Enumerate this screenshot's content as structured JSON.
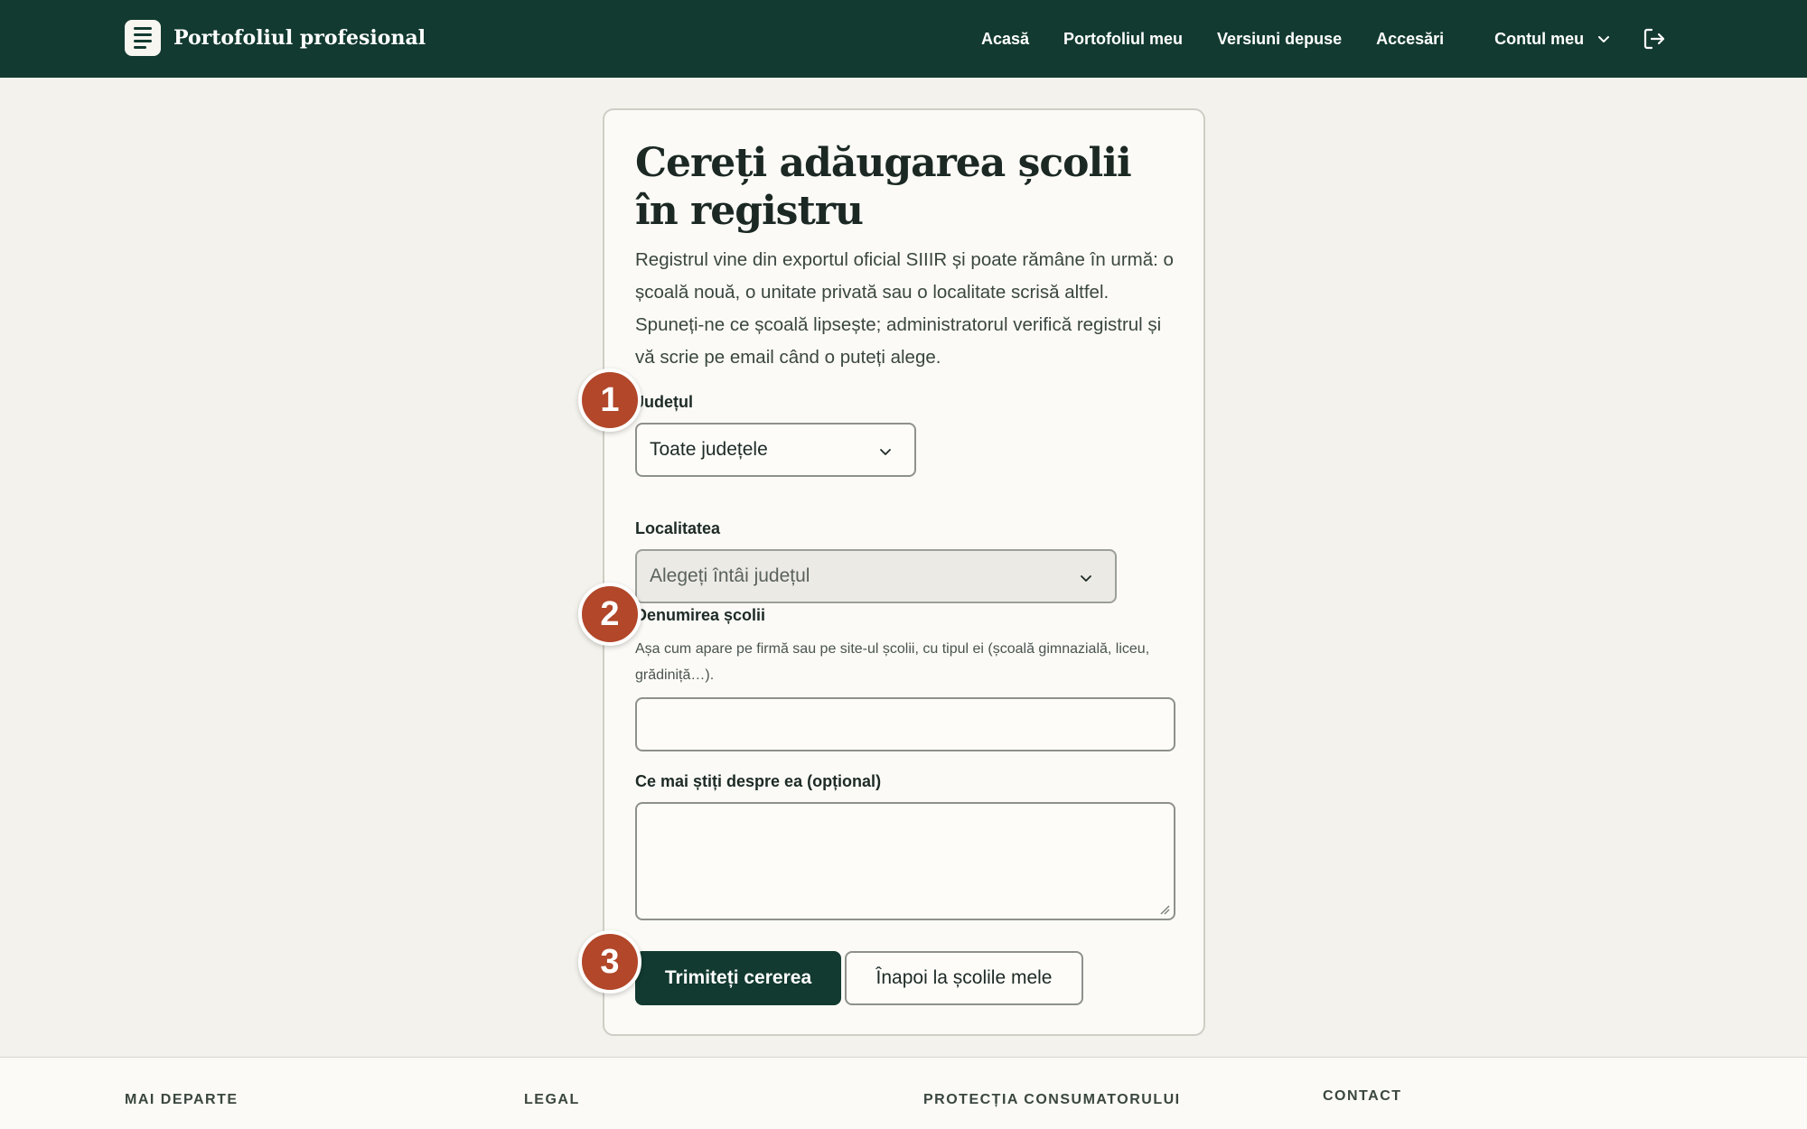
{
  "header": {
    "brand": "Portofoliul profesional",
    "nav": [
      "Acasă",
      "Portofoliul meu",
      "Versiuni depuse",
      "Accesări"
    ],
    "account_label": "Contul meu"
  },
  "form": {
    "title": "Cereți adăugarea școlii în registru",
    "intro": "Registrul vine din exportul oficial SIIIR și poate rămâne în urmă: o școală nouă, o unitate privată sau o localitate scrisă altfel. Spuneți-ne ce școală lipsește; administratorul verifică registrul și vă scrie pe email când o puteți alege.",
    "county_label": "Județul",
    "county_value": "Toate județele",
    "locality_label": "Localitatea",
    "locality_value": "Alegeți întâi județul",
    "school_label": "Denumirea școlii",
    "school_help": "Așa cum apare pe firmă sau pe site-ul școlii, cu tipul ei (școală gimnazială, liceu, grădiniță…).",
    "school_value": "",
    "notes_label": "Ce mai știți despre ea (opțional)",
    "notes_value": "",
    "submit": "Trimiteți cererea",
    "back": "Înapoi la școlile mele"
  },
  "markers": [
    "1",
    "2",
    "3"
  ],
  "footer": {
    "columns": [
      "MAI DEPARTE",
      "LEGAL",
      "PROTECȚIA CONSUMATORULUI",
      "CONTACT"
    ]
  },
  "colors": {
    "header_bg": "#123a30",
    "marker": "#b2472a",
    "page_bg": "#f3f2ec"
  }
}
